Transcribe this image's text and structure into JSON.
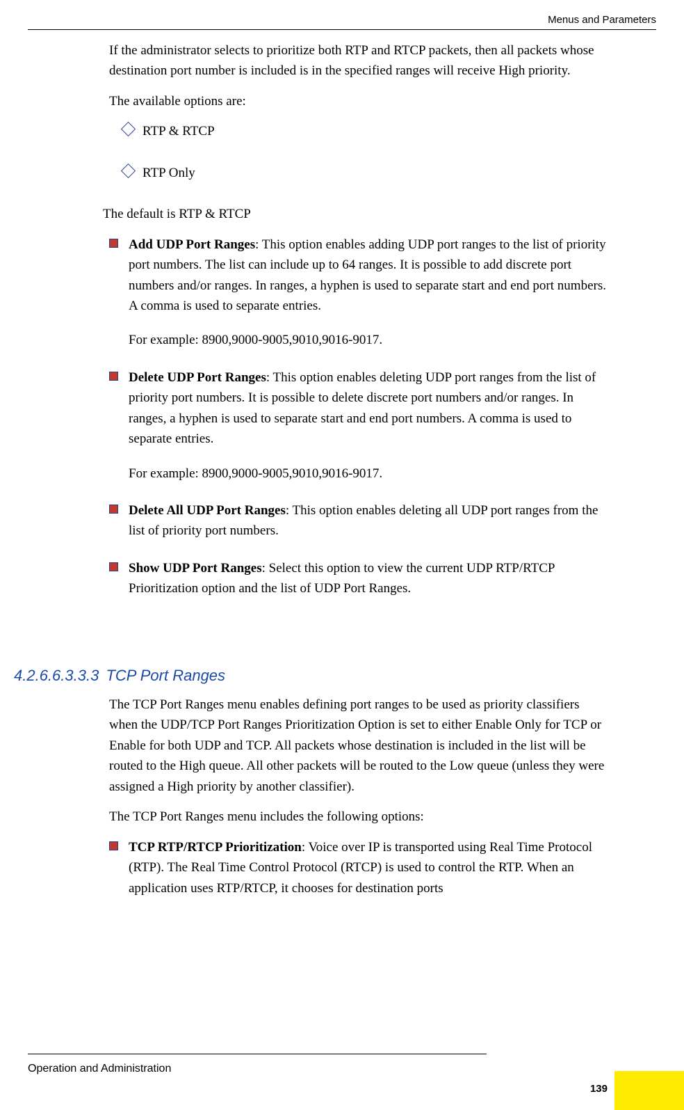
{
  "header": {
    "right_text": "Menus and Parameters"
  },
  "content": {
    "p1": "If the administrator selects to prioritize both RTP and RTCP packets, then all packets whose destination port number is included is in the specified ranges will receive High priority.",
    "p2": "The available options are:",
    "options": {
      "o1": "RTP & RTCP",
      "o2": "RTP Only"
    },
    "default_line": " The default is RTP & RTCP",
    "items": {
      "i1_bold": "Add UDP Port Ranges",
      "i1_rest": ": This option enables adding UDP port ranges to the list of priority port numbers. The list can include up to 64 ranges. It is possible to add discrete port numbers and/or ranges. In ranges, a hyphen is used to separate start and end port numbers. A comma is used to separate entries.",
      "i1_ex": "For example: 8900,9000-9005,9010,9016-9017.",
      "i2_bold": "Delete UDP Port Ranges",
      "i2_rest": ": This option enables deleting UDP port ranges from the list of priority port numbers. It is possible to delete discrete port numbers and/or ranges. In ranges, a hyphen is used to separate start and end port numbers. A comma is used to separate entries.",
      "i2_ex": "For example: 8900,9000-9005,9010,9016-9017.",
      "i3_bold": "Delete All UDP Port Ranges",
      "i3_rest": ": This option enables deleting all UDP port ranges from the list of priority port numbers.",
      "i4_bold": "Show UDP Port Ranges",
      "i4_rest": ": Select this option to view the current UDP RTP/RTCP Prioritization option and the list of UDP Port Ranges."
    },
    "section": {
      "number": "4.2.6.6.3.3.3",
      "title": "TCP Port Ranges"
    },
    "tcp_p1": "The TCP Port Ranges menu enables defining port ranges to be used as priority classifiers when the UDP/TCP Port Ranges Prioritization Option is set to either Enable Only for TCP or Enable for both UDP and TCP. All packets whose destination is included in the list will be routed to the High queue. All other packets will be routed to the Low queue (unless they were assigned a High priority by another classifier).",
    "tcp_p2": "The TCP Port Ranges menu includes the following options:",
    "tcp_item_bold": "TCP RTP/RTCP Prioritization",
    "tcp_item_rest": ": Voice over IP is transported using Real Time Protocol (RTP). The Real Time Control Protocol (RTCP) is used to control the RTP. When an application uses RTP/RTCP, it chooses for destination ports"
  },
  "footer": {
    "text": "Operation and Administration",
    "page": "139"
  }
}
